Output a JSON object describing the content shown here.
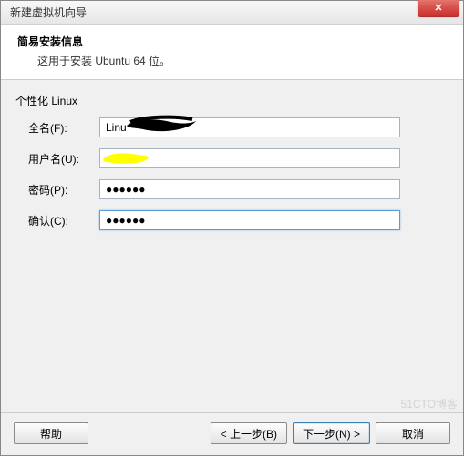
{
  "window": {
    "title": "新建虚拟机向导",
    "close_glyph": "✕"
  },
  "header": {
    "title": "简易安装信息",
    "subtitle": "这用于安装 Ubuntu 64 位。"
  },
  "section": {
    "title": "个性化 Linux"
  },
  "fields": {
    "fullname": {
      "label": "全名(F):",
      "value": "Linu"
    },
    "username": {
      "label": "用户名(U):",
      "value": ""
    },
    "password": {
      "label": "密码(P):",
      "value": "●●●●●●"
    },
    "confirm": {
      "label": "确认(C):",
      "value": "●●●●●●"
    }
  },
  "buttons": {
    "help": "帮助",
    "back": "< 上一步(B)",
    "next": "下一步(N) >",
    "cancel": "取消"
  },
  "watermark": "51CTO博客"
}
